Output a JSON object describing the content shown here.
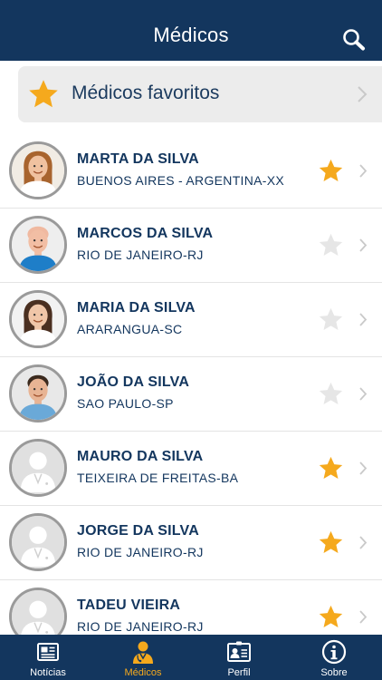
{
  "header": {
    "title": "Médicos",
    "search_icon": "search-icon"
  },
  "favorites": {
    "label": "Médicos favoritos",
    "icon": "star-icon"
  },
  "colors": {
    "brand": "#13365e",
    "accent": "#f5a91d",
    "star_off": "#e6e6e6"
  },
  "doctors": [
    {
      "name": "MARTA DA SILVA",
      "city": "BUENOS AIRES - ARGENTINA-XX",
      "favorite": true,
      "photo": "female-blond"
    },
    {
      "name": "MARCOS DA SILVA",
      "city": "RIO DE JANEIRO-RJ",
      "favorite": false,
      "photo": "male-bald"
    },
    {
      "name": "MARIA DA SILVA",
      "city": "ARARANGUA-SC",
      "favorite": false,
      "photo": "female-dark"
    },
    {
      "name": "JOÃO DA SILVA",
      "city": "SAO PAULO-SP",
      "favorite": false,
      "photo": "male-dark"
    },
    {
      "name": "MAURO DA SILVA",
      "city": "TEIXEIRA DE FREITAS-BA",
      "favorite": true,
      "photo": "placeholder"
    },
    {
      "name": "JORGE DA SILVA",
      "city": "RIO DE JANEIRO-RJ",
      "favorite": true,
      "photo": "placeholder"
    },
    {
      "name": "TADEU VIEIRA",
      "city": "RIO DE JANEIRO-RJ",
      "favorite": true,
      "photo": "placeholder"
    }
  ],
  "tabs": [
    {
      "label": "Notícias",
      "icon": "newspaper-icon",
      "active": false
    },
    {
      "label": "Médicos",
      "icon": "doctor-icon",
      "active": true
    },
    {
      "label": "Perfil",
      "icon": "id-card-icon",
      "active": false
    },
    {
      "label": "Sobre",
      "icon": "info-icon",
      "active": false
    }
  ]
}
